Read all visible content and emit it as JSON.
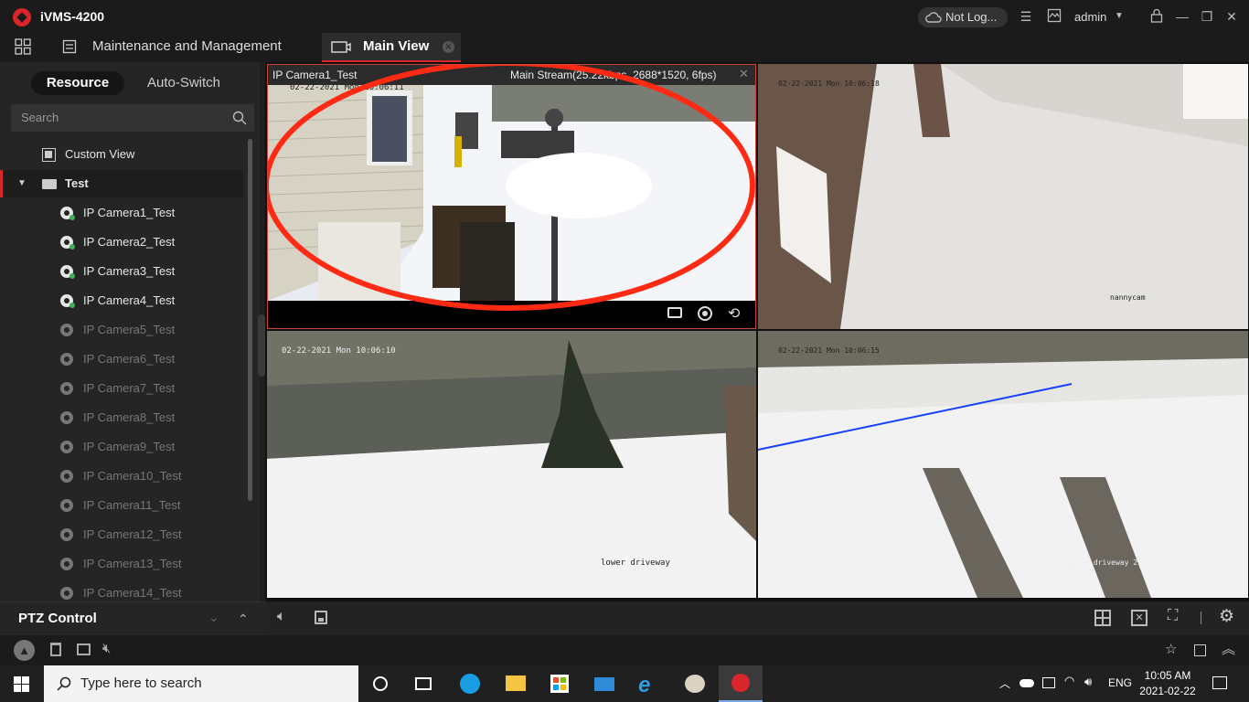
{
  "app": {
    "title": "iVMS-4200"
  },
  "titlebar": {
    "cloud_label": "Not Log...",
    "user": "admin"
  },
  "tabs": {
    "maintenance": "Maintenance and Management",
    "main_view": "Main View"
  },
  "sidebar": {
    "segments": [
      "Resource",
      "Auto-Switch"
    ],
    "search_placeholder": "Search",
    "custom_view": "Custom View",
    "group": "Test",
    "cameras": [
      {
        "label": "IP Camera1_Test",
        "online": true
      },
      {
        "label": "IP Camera2_Test",
        "online": true
      },
      {
        "label": "IP Camera3_Test",
        "online": true
      },
      {
        "label": "IP Camera4_Test",
        "online": true
      },
      {
        "label": "IP Camera5_Test",
        "online": false
      },
      {
        "label": "IP Camera6_Test",
        "online": false
      },
      {
        "label": "IP Camera7_Test",
        "online": false
      },
      {
        "label": "IP Camera8_Test",
        "online": false
      },
      {
        "label": "IP Camera9_Test",
        "online": false
      },
      {
        "label": "IP Camera10_Test",
        "online": false
      },
      {
        "label": "IP Camera11_Test",
        "online": false
      },
      {
        "label": "IP Camera12_Test",
        "online": false
      },
      {
        "label": "IP Camera13_Test",
        "online": false
      },
      {
        "label": "IP Camera14_Test",
        "online": false
      }
    ]
  },
  "ptz": {
    "label": "PTZ Control"
  },
  "panes": [
    {
      "camera": "IP Camera1_Test",
      "stream": "Main Stream(25.22kbps, 2688*1520, 6fps)",
      "osd_time": "02-22-2021 Mon 10:06:11",
      "caption": ""
    },
    {
      "camera": "",
      "stream": "",
      "osd_time": "02-22-2021 Mon 10:06:18",
      "caption": "nannycam"
    },
    {
      "camera": "",
      "stream": "",
      "osd_time": "02-22-2021 Mon 10:06:10",
      "caption": "lower driveway"
    },
    {
      "camera": "",
      "stream": "",
      "osd_time": "02-22-2021 Mon 10:06:15",
      "caption": "upper driveway 2"
    }
  ],
  "taskbar": {
    "search_placeholder": "Type here to search",
    "lang": "ENG",
    "time": "10:05 AM",
    "date": "2021-02-22"
  },
  "colors": {
    "accent": "#d8262b",
    "annotation": "#ff2a14",
    "line": "#1640ff"
  }
}
